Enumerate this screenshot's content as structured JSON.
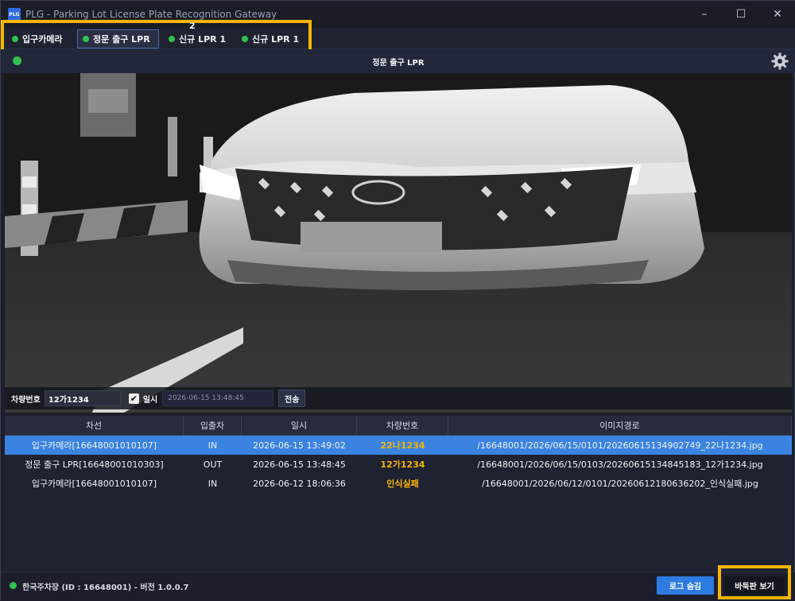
{
  "window": {
    "title": "PLG - Parking Lot License Plate Recognition Gateway",
    "logo_text": "PLG",
    "min": "–",
    "max": "☐",
    "close": "✕"
  },
  "tabs": [
    {
      "label": "입구카메라"
    },
    {
      "label": "정문 출구 LPR"
    },
    {
      "label": "신규 LPR 1"
    },
    {
      "label": "신규 LPR 1"
    }
  ],
  "tab_badge": "2",
  "camera": {
    "title": "정문 출구 LPR"
  },
  "controls": {
    "plate_label": "차량번호",
    "plate_value": "12가1234",
    "datetime_checkbox": "✔",
    "datetime_label": "일시",
    "datetime_value": "2026-06-15 13:48:45",
    "send": "전송"
  },
  "table": {
    "headers": [
      "차선",
      "입출차",
      "일시",
      "차량번호",
      "이미지경로"
    ],
    "rows": [
      [
        "입구카메라[16648001010107]",
        "IN",
        "2026-06-15 13:49:02",
        "22나1234",
        "/16648001/2026/06/15/0101/20260615134902749_22나1234.jpg"
      ],
      [
        "정문 출구 LPR[16648001010303]",
        "OUT",
        "2026-06-15 13:48:45",
        "12가1234",
        "/16648001/2026/06/15/0103/20260615134845183_12가1234.jpg"
      ],
      [
        "입구카메라[16648001010107]",
        "IN",
        "2026-06-12 18:06:36",
        "인식실패",
        "/16648001/2026/06/12/0101/20260612180636202_인식실패.jpg"
      ]
    ]
  },
  "status": {
    "text": "한국주차장 (ID : 16648001) - 버전 1.0.0.7"
  },
  "buttons": {
    "hide_log": "로그 숨김",
    "board_view": "바둑판 보기"
  },
  "colors": {
    "accent": "#2d7be0",
    "highlight": "#f7b500",
    "status_ok": "#31c24d",
    "selected_row": "#3a83e0"
  }
}
